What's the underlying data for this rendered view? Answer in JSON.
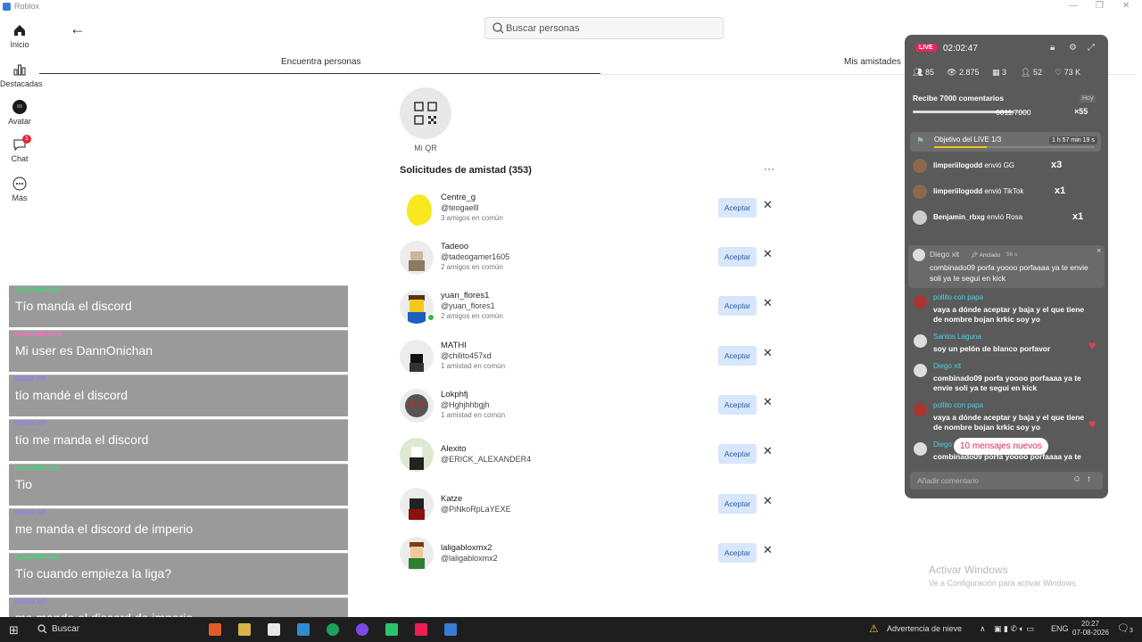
{
  "window": {
    "title": "Roblox"
  },
  "nav": [
    {
      "label": "Inicio",
      "icon": "home-icon"
    },
    {
      "label": "Destacadas",
      "icon": "charts-icon"
    },
    {
      "label": "Avatar",
      "icon": "avatar-icon"
    },
    {
      "label": "Chat",
      "icon": "chat-icon",
      "badge": "1"
    },
    {
      "label": "Más",
      "icon": "more-icon"
    }
  ],
  "search": {
    "placeholder": "Buscar personas"
  },
  "tabs": {
    "left": "Encuentra personas",
    "right": "Mis amistades"
  },
  "qr": {
    "label": "Mi QR"
  },
  "requests": {
    "title": "Solicitudes de amistad (353)",
    "more": "···",
    "accept_label": "Aceptar",
    "reject_label": "✕",
    "items": [
      {
        "name": "Centre_g",
        "user": "@teogaelll",
        "mutual": "3 amigos en común"
      },
      {
        "name": "Tadeoo",
        "user": "@tadeogamer1605",
        "mutual": "2 amigos en común"
      },
      {
        "name": "yuan_flores1",
        "user": "@yuan_flores1",
        "mutual": "2 amigos en común"
      },
      {
        "name": "MATHI",
        "user": "@chilito457xd",
        "mutual": "1 amistad en común"
      },
      {
        "name": "Lokphfj",
        "user": "@Hghjhhbgjh",
        "mutual": "1 amistad en común"
      },
      {
        "name": "Alexito",
        "user": "@ERICK_ALEXANDER4",
        "mutual": ""
      },
      {
        "name": "Katze",
        "user": "@PiNkoRpLaYEXE",
        "mutual": ""
      },
      {
        "name": "laligabloxmx2",
        "user": "@laligabloxmx2",
        "mutual": ""
      }
    ]
  },
  "chat_overlay": [
    {
      "user": "ALVAROCHINO",
      "text": "Tío manda el discord",
      "color": "#2ee66e"
    },
    {
      "user": "DANNONICHAN",
      "text": "Mi user es DannOnichan",
      "color": "#ff6ec7"
    },
    {
      "user": "DIEGO XIT",
      "text": "tío mandé el discord",
      "color": "#8a7dff"
    },
    {
      "user": "DIEGO XIT",
      "text": "tío me manda el discord",
      "color": "#8a7dff"
    },
    {
      "user": "ALVAROCHINO",
      "text": "Tio",
      "color": "#2ee66e"
    },
    {
      "user": "DIEGO XIT",
      "text": "me manda el discord de imperio",
      "color": "#8a7dff"
    },
    {
      "user": "ALVAROCHINO",
      "text": "Tío cuando empieza la liga?",
      "color": "#2ee66e"
    },
    {
      "user": "DIEGO XIT",
      "text": "me manda el discord de imperio",
      "color": "#8a7dff"
    }
  ],
  "live": {
    "tag": "LIVE",
    "timer": "02:02:47",
    "stats": [
      "85",
      "2.875",
      "3",
      "52",
      "73 K"
    ],
    "goal": {
      "title": "Recibe 7000 comentarios",
      "day": "Hoy",
      "count": "6011/7000",
      "gift": "×55",
      "progress": 0.86
    },
    "objective": {
      "text": "Objetivo del LIVE 1/3",
      "time": "1 h 57 min 19 s",
      "progress": 0.33
    },
    "gifts": [
      {
        "user": "limperiilogodd",
        "action": "envió GG",
        "mult": "x3"
      },
      {
        "user": "limperiilogodd",
        "action": "envió TikTok",
        "mult": "x1"
      },
      {
        "user": "Benjamin_rbxg",
        "action": "envió Rosa",
        "mult": "x1"
      }
    ],
    "pinned": {
      "user": "Diego xit",
      "pin": "Anclado",
      "age": "56 s",
      "text": "combinado09 porfa yoooo porfaaaa ya te envie soli ya te segui en kick",
      "close": "×"
    },
    "comments": [
      {
        "user": "pollito con papa",
        "text": "vaya a dónde aceptar y baja y el que tiene de nombre bojan krkic soy yo"
      },
      {
        "user": "Santos Laguna",
        "text": "soy un pelón de blanco porfavor"
      },
      {
        "user": "Diego xit",
        "text": "combinado09 porfa yoooo porfaaaa ya te envie soli ya te segui en kick"
      },
      {
        "user": "pollito con papa",
        "text": "vaya a dónde aceptar y baja y el que tiene de nombre bojan krkic soy yo"
      },
      {
        "user": "Diego xit",
        "text": "combinado09 porfa yoooo porfaaaa ya te"
      }
    ],
    "new_messages": "10 mensajes nuevos",
    "comment_placeholder": "Añadir comentario"
  },
  "watermark": {
    "line1": "Activar Windows",
    "line2": "Ve a Configuración para activar Windows."
  },
  "taskbar": {
    "search": "Buscar",
    "weather": "Advertencia de nieve",
    "lang": "ENG",
    "time": "20:27",
    "date": "07-08-2026",
    "notif": "3"
  }
}
